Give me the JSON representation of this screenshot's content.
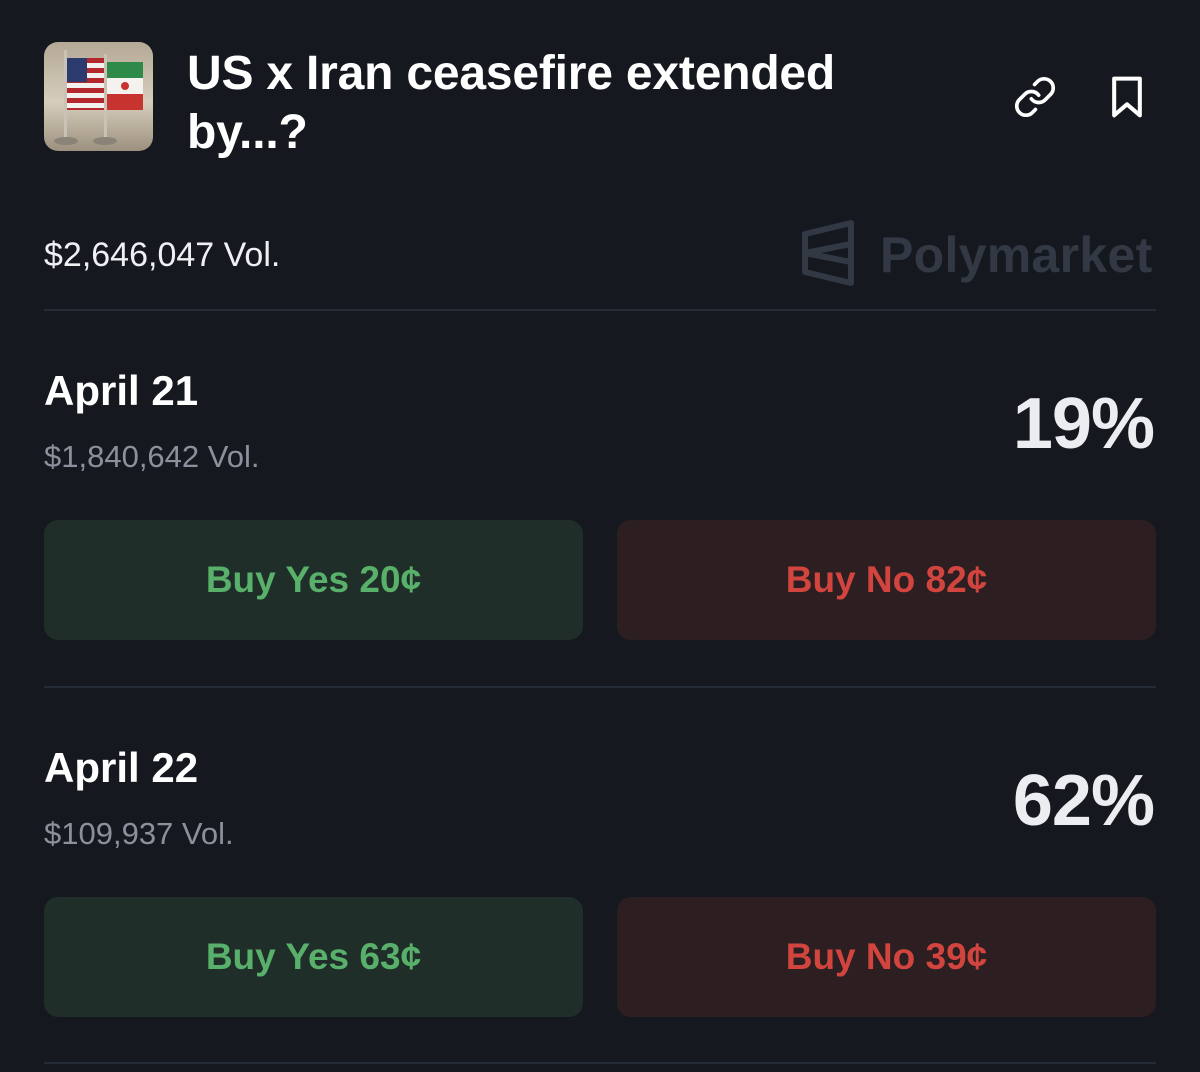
{
  "market": {
    "title": "US x Iran ceasefire extended by...?",
    "total_volume": "$2,646,047 Vol.",
    "thumbnail_icon": "us-iran-flags-image",
    "share_icon": "link-icon",
    "save_icon": "bookmark-icon"
  },
  "brand": {
    "name": "Polymarket",
    "logo_icon": "polymarket-logo-icon"
  },
  "outcomes": [
    {
      "date": "April 21",
      "volume": "$1,840,642 Vol.",
      "probability": "19%",
      "buy_yes": "Buy Yes 20¢",
      "buy_no": "Buy No 82¢"
    },
    {
      "date": "April 22",
      "volume": "$109,937 Vol.",
      "probability": "62%",
      "buy_yes": "Buy Yes 63¢",
      "buy_no": "Buy No 39¢"
    }
  ],
  "colors": {
    "background": "#15191f",
    "yes_text": "#58b06b",
    "yes_bg": "#1f2e28",
    "no_text": "#d2453f",
    "no_bg": "#2d1e21"
  }
}
